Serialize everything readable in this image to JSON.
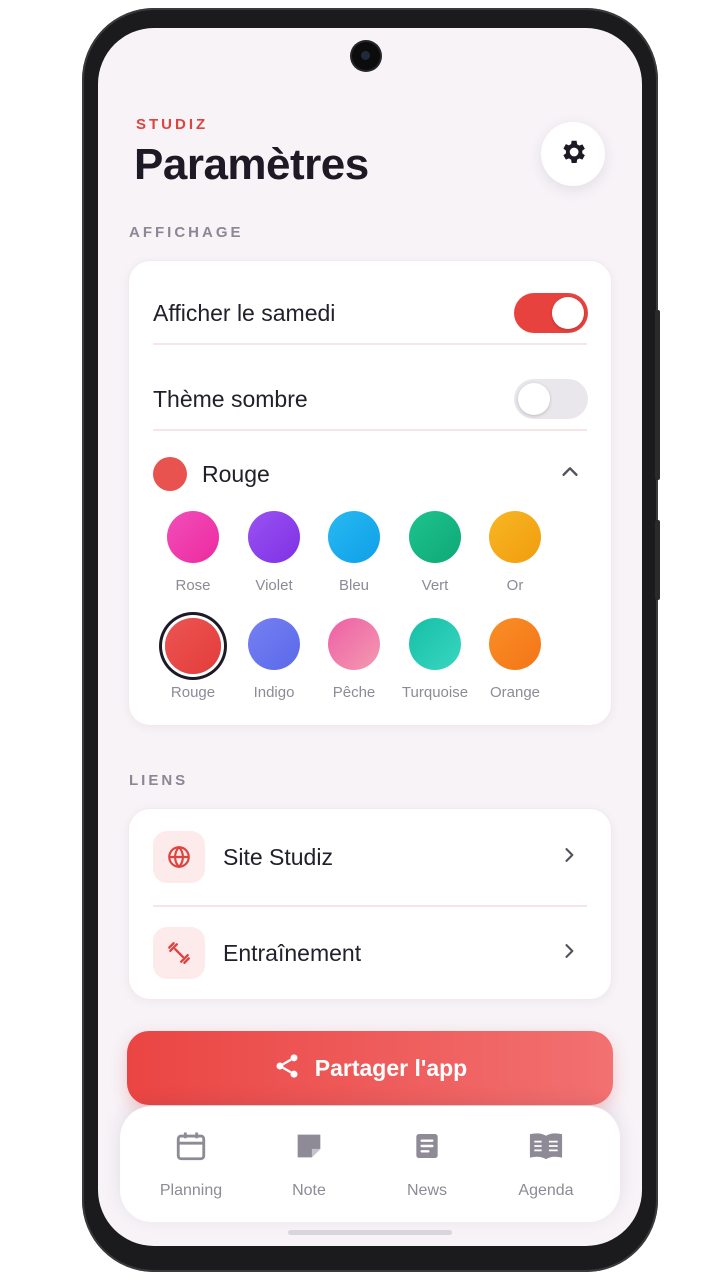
{
  "header": {
    "brand": "STUDIZ",
    "title": "Paramètres",
    "settings_icon": "gear-icon"
  },
  "display": {
    "section_label": "AFFICHAGE",
    "show_saturday": {
      "label": "Afficher le samedi",
      "on": true
    },
    "dark_theme": {
      "label": "Thème sombre",
      "on": false
    },
    "theme_color": {
      "selected_label": "Rouge",
      "selected_color": "#e8524f",
      "expanded": true,
      "swatches": [
        {
          "name": "Rose",
          "color": "#f13fae"
        },
        {
          "name": "Violet",
          "color": "#8a40ea"
        },
        {
          "name": "Bleu",
          "color": "#1cadee"
        },
        {
          "name": "Vert",
          "color": "#16bb82"
        },
        {
          "name": "Or",
          "color": "#f4aa17"
        },
        {
          "name": "Rouge",
          "color": "#e84845",
          "selected": true
        },
        {
          "name": "Indigo",
          "color": "#6372ee"
        },
        {
          "name": "Pêche",
          "color": "#f07aa9"
        },
        {
          "name": "Turquoise",
          "color": "#1cc6ae"
        },
        {
          "name": "Orange",
          "color": "#f8821f"
        }
      ]
    }
  },
  "links": {
    "section_label": "LIENS",
    "items": [
      {
        "label": "Site Studiz",
        "icon": "globe-icon"
      },
      {
        "label": "Entraînement",
        "icon": "dumbbell-icon"
      }
    ]
  },
  "share_button": {
    "label": "Partager l'app",
    "icon": "share-icon"
  },
  "bottom_nav": [
    {
      "label": "Planning",
      "icon": "calendar-icon"
    },
    {
      "label": "Note",
      "icon": "note-icon"
    },
    {
      "label": "News",
      "icon": "news-icon"
    },
    {
      "label": "Agenda",
      "icon": "book-icon"
    }
  ],
  "colors": {
    "accent": "#e8423f",
    "muted": "#8e8a96",
    "background": "#f7f3f7"
  }
}
